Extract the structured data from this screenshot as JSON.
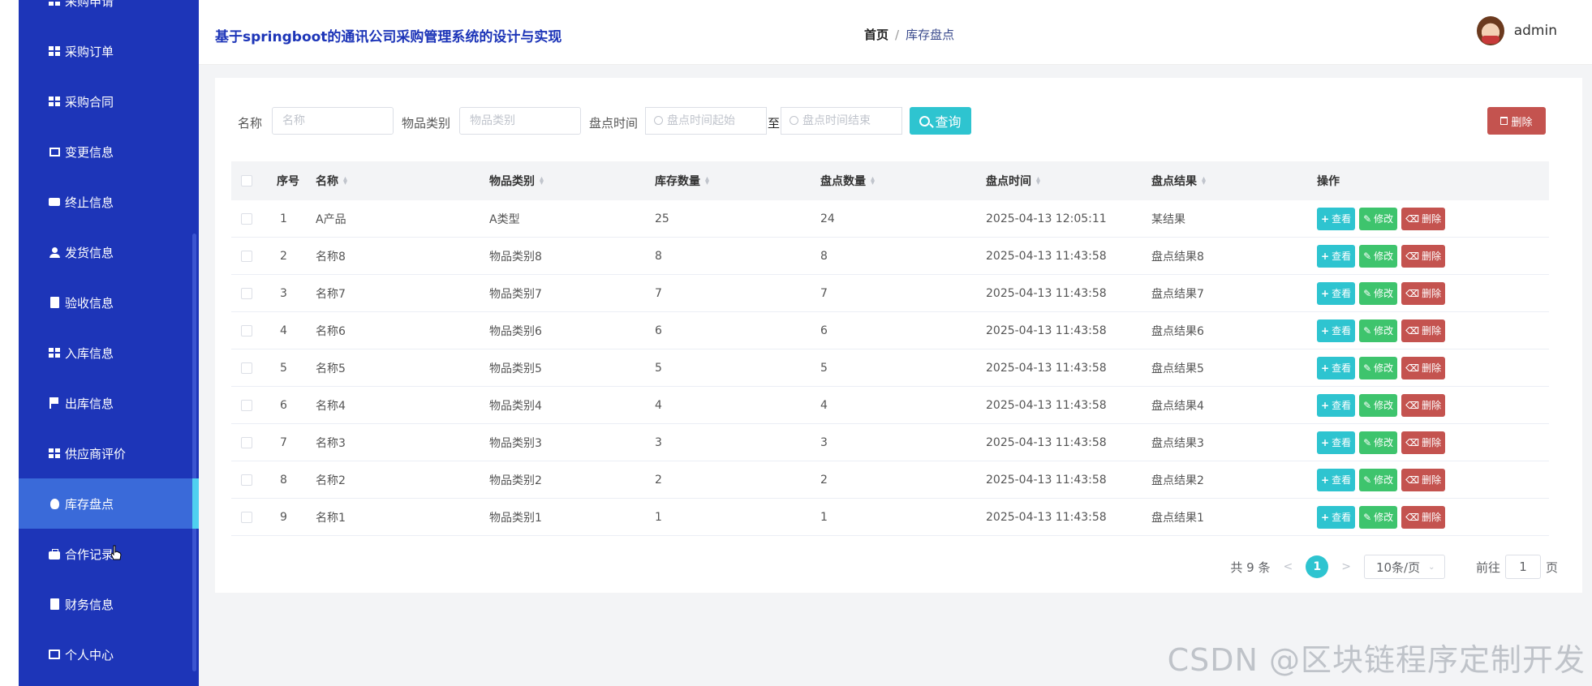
{
  "app": {
    "title": "基于springboot的通讯公司采购管理系统的设计与实现"
  },
  "breadcrumb": {
    "home": "首页",
    "separator": "/",
    "current": "库存盘点"
  },
  "user": {
    "name": "admin"
  },
  "sidebar": {
    "items": [
      {
        "label": "采购申请",
        "icon": "grid-icon"
      },
      {
        "label": "采购订单",
        "icon": "grid-icon"
      },
      {
        "label": "采购合同",
        "icon": "grid-icon"
      },
      {
        "label": "变更信息",
        "icon": "picture-icon"
      },
      {
        "label": "终止信息",
        "icon": "message-icon"
      },
      {
        "label": "发货信息",
        "icon": "user-icon"
      },
      {
        "label": "验收信息",
        "icon": "clipboard-icon"
      },
      {
        "label": "入库信息",
        "icon": "grid-icon"
      },
      {
        "label": "出库信息",
        "icon": "flag-icon"
      },
      {
        "label": "供应商评价",
        "icon": "grid-icon"
      },
      {
        "label": "库存盘点",
        "icon": "bulb-icon",
        "active": true
      },
      {
        "label": "合作记录",
        "icon": "briefcase-icon"
      },
      {
        "label": "财务信息",
        "icon": "clipboard-icon"
      },
      {
        "label": "个人中心",
        "icon": "card-icon"
      }
    ]
  },
  "search": {
    "name_label": "名称",
    "name_placeholder": "名称",
    "category_label": "物品类别",
    "category_placeholder": "物品类别",
    "time_label": "盘点时间",
    "time_start_placeholder": "盘点时间起始",
    "to_label": "至",
    "time_end_placeholder": "盘点时间结束",
    "query_button": "查询",
    "delete_button": "删除"
  },
  "table": {
    "headers": [
      "序号",
      "名称",
      "物品类别",
      "库存数量",
      "盘点数量",
      "盘点时间",
      "盘点结果",
      "操作"
    ],
    "rows": [
      {
        "no": "1",
        "name": "A产品",
        "category": "A类型",
        "stock": "25",
        "count": "24",
        "time": "2025-04-13 12:05:11",
        "result": "某结果"
      },
      {
        "no": "2",
        "name": "名称8",
        "category": "物品类别8",
        "stock": "8",
        "count": "8",
        "time": "2025-04-13 11:43:58",
        "result": "盘点结果8"
      },
      {
        "no": "3",
        "name": "名称7",
        "category": "物品类别7",
        "stock": "7",
        "count": "7",
        "time": "2025-04-13 11:43:58",
        "result": "盘点结果7"
      },
      {
        "no": "4",
        "name": "名称6",
        "category": "物品类别6",
        "stock": "6",
        "count": "6",
        "time": "2025-04-13 11:43:58",
        "result": "盘点结果6"
      },
      {
        "no": "5",
        "name": "名称5",
        "category": "物品类别5",
        "stock": "5",
        "count": "5",
        "time": "2025-04-13 11:43:58",
        "result": "盘点结果5"
      },
      {
        "no": "6",
        "name": "名称4",
        "category": "物品类别4",
        "stock": "4",
        "count": "4",
        "time": "2025-04-13 11:43:58",
        "result": "盘点结果4"
      },
      {
        "no": "7",
        "name": "名称3",
        "category": "物品类别3",
        "stock": "3",
        "count": "3",
        "time": "2025-04-13 11:43:58",
        "result": "盘点结果3"
      },
      {
        "no": "8",
        "name": "名称2",
        "category": "物品类别2",
        "stock": "2",
        "count": "2",
        "time": "2025-04-13 11:43:58",
        "result": "盘点结果2"
      },
      {
        "no": "9",
        "name": "名称1",
        "category": "物品类别1",
        "stock": "1",
        "count": "1",
        "time": "2025-04-13 11:43:58",
        "result": "盘点结果1"
      }
    ],
    "actions": {
      "view": "查看",
      "edit": "修改",
      "delete": "删除"
    }
  },
  "pagination": {
    "total": "共 9 条",
    "prev": "<",
    "current_page": "1",
    "next": ">",
    "page_size": "10条/页",
    "goto_label": "前往",
    "goto_value": "1",
    "page_unit": "页"
  },
  "watermark": "CSDN @区块链程序定制开发",
  "colors": {
    "sidebar": "#1d35b8",
    "active": "#3a6ad9",
    "accent": "#2ec4d0",
    "edit": "#3ec46d",
    "danger": "#c4534f"
  }
}
